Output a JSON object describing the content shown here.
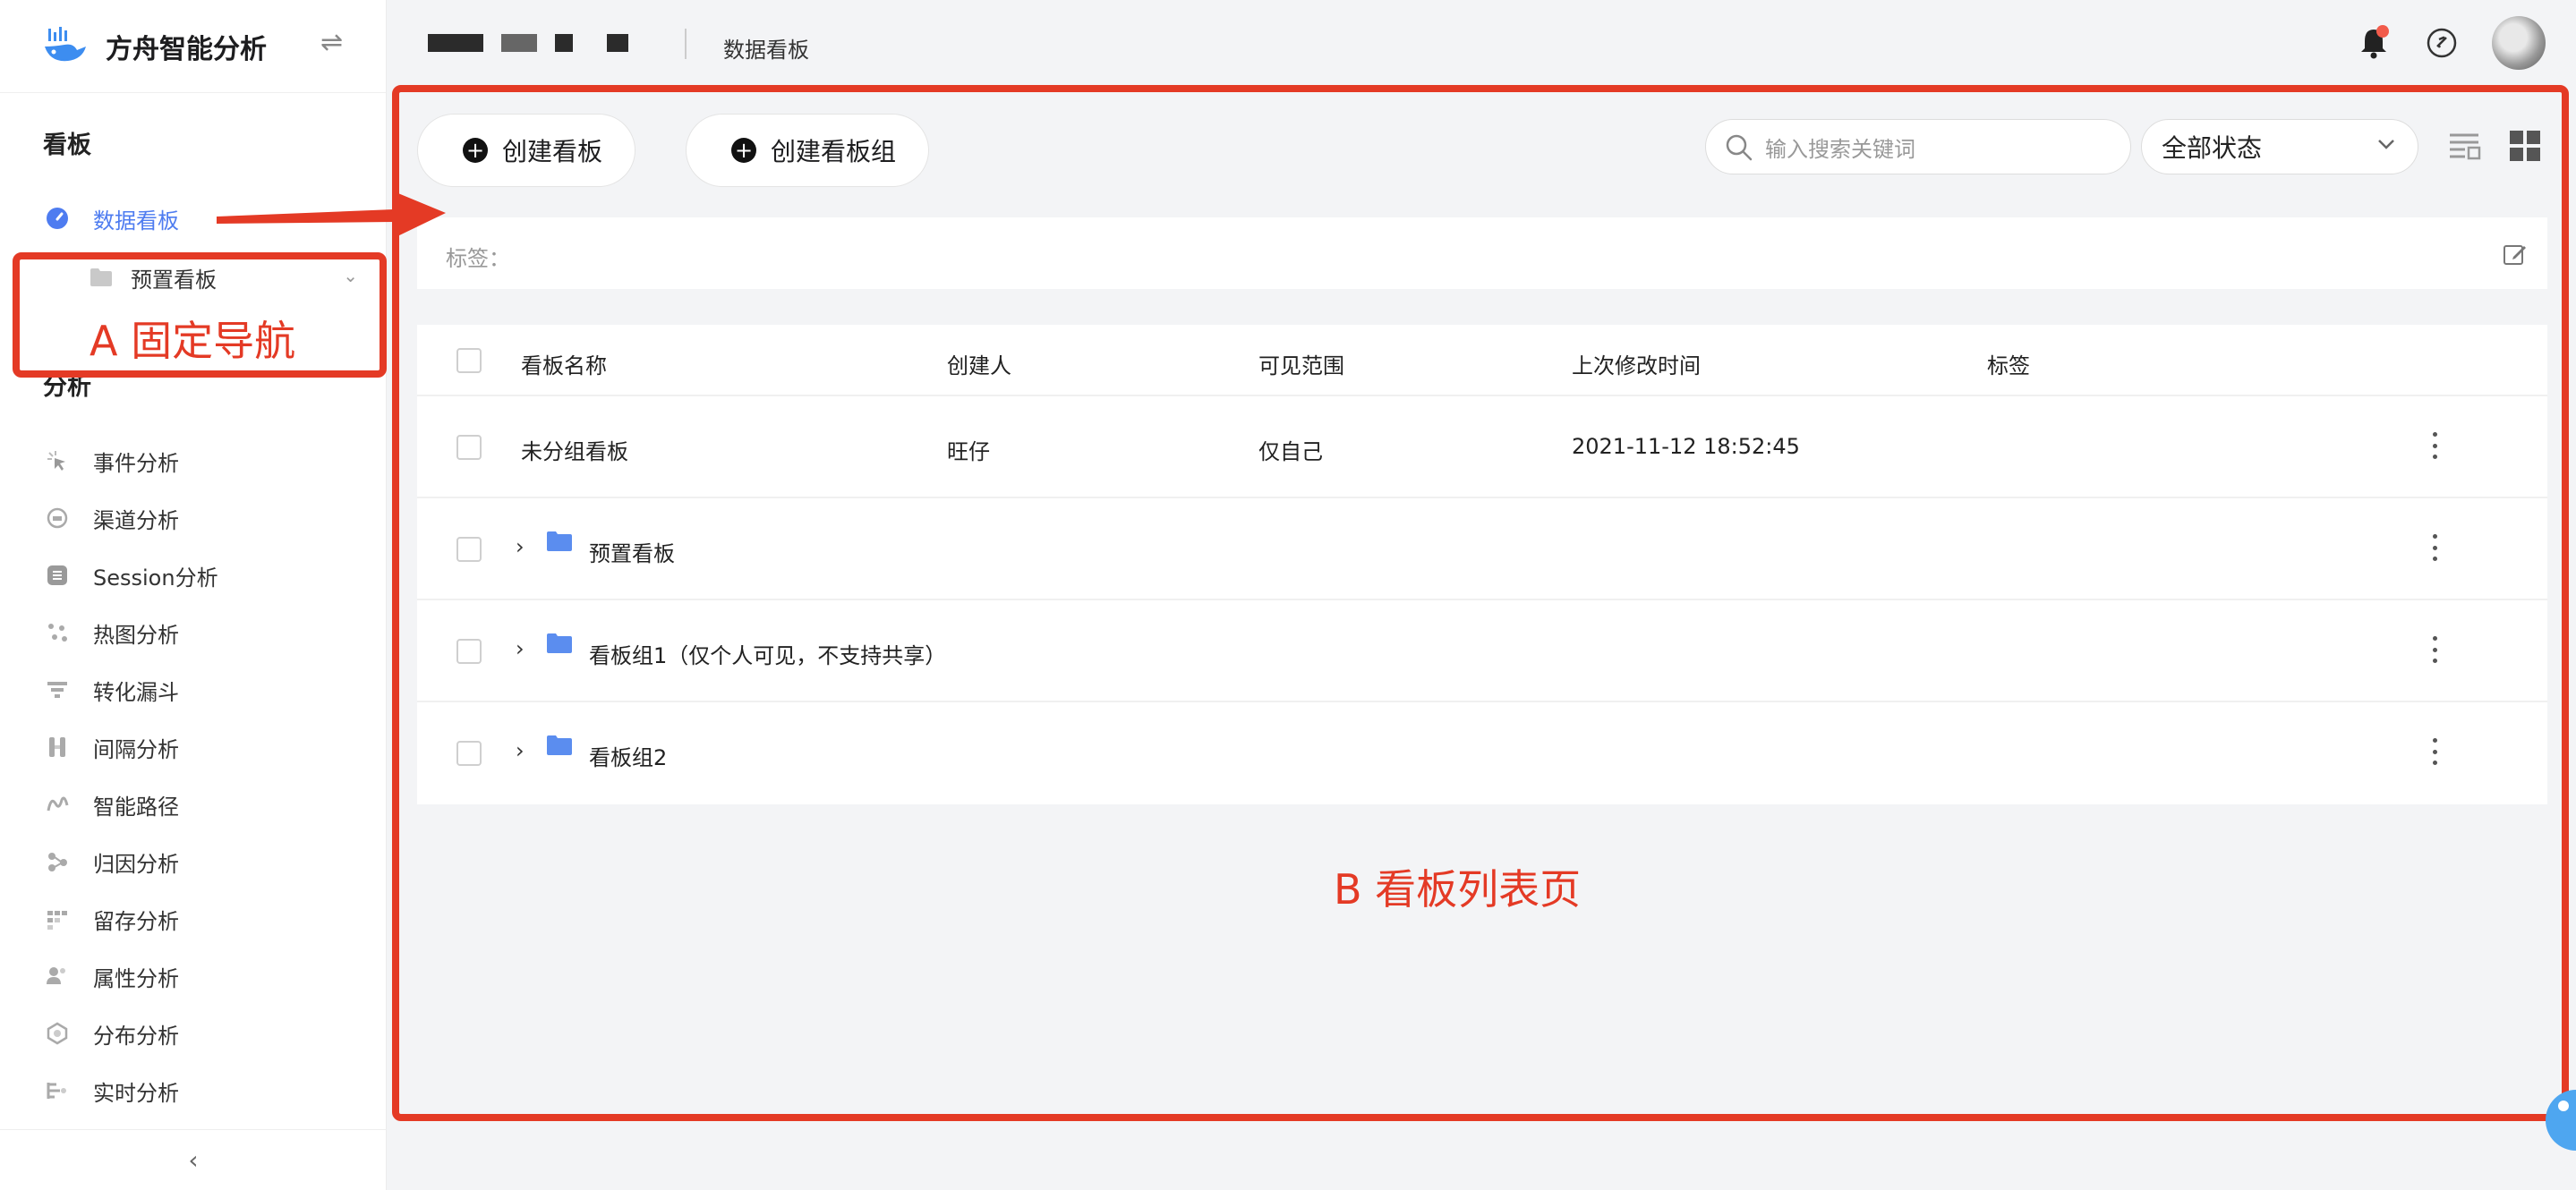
{
  "brand": {
    "title": "方舟智能分析"
  },
  "breadcrumb": {
    "current": "数据看板"
  },
  "sidebar": {
    "section_board": "看板",
    "section_analysis": "分析",
    "active_item": "数据看板",
    "sub_item": "预置看板",
    "items": [
      "事件分析",
      "渠道分析",
      "Session分析",
      "热图分析",
      "转化漏斗",
      "间隔分析",
      "智能路径",
      "归因分析",
      "留存分析",
      "属性分析",
      "分布分析",
      "实时分析"
    ]
  },
  "toolbar": {
    "create_board": "创建看板",
    "create_group": "创建看板组",
    "search_placeholder": "输入搜索关键词",
    "status_select": "全部状态"
  },
  "tags": {
    "label": "标签："
  },
  "table": {
    "columns": [
      "看板名称",
      "创建人",
      "可见范围",
      "上次修改时间",
      "标签"
    ],
    "rows": [
      {
        "name": "未分组看板",
        "creator": "旺仔",
        "scope": "仅自己",
        "modified": "2021-11-12 18:52:45"
      }
    ],
    "groups": [
      "预置看板",
      "看板组1（仅个人可见，不支持共享）",
      "看板组2"
    ]
  },
  "annotations": {
    "a": "A 固定导航",
    "b": "B 看板列表页"
  },
  "colors": {
    "accent": "#4e7cf0",
    "annotation": "#e43a25",
    "folder": "#5b8def"
  }
}
